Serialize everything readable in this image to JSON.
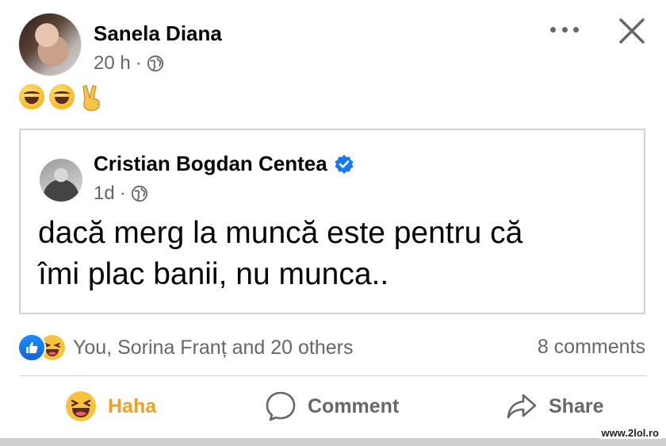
{
  "post": {
    "author_name": "Sanela Diana",
    "timestamp": "20 h",
    "separator": "·",
    "audience_icon": "globe-icon",
    "emojis": [
      "face-with-tears-of-joy",
      "face-with-tears-of-joy",
      "victory-hand"
    ]
  },
  "shared_post": {
    "author_name": "Cristian Bogdan Centea",
    "verified_icon": "verified-badge-icon",
    "timestamp": "1d",
    "separator": "·",
    "text_line1": "dacă merg la muncă este pentru că",
    "text_line2": "îmi plac banii, nu munca.."
  },
  "engagement": {
    "reactions_text": "You, Sorina Franț and 20 others",
    "comments_text": "8 comments",
    "reaction_icons": [
      "like-icon",
      "haha-icon"
    ]
  },
  "actions": {
    "haha_label": "Haha",
    "comment_label": "Comment",
    "share_label": "Share"
  },
  "watermark": "www.2lol.ro",
  "colors": {
    "primary_text": "#050505",
    "secondary_text": "#65676b",
    "haha_active": "#f0a124",
    "verified_blue": "#1877f2",
    "like_blue": "#1877f2"
  }
}
